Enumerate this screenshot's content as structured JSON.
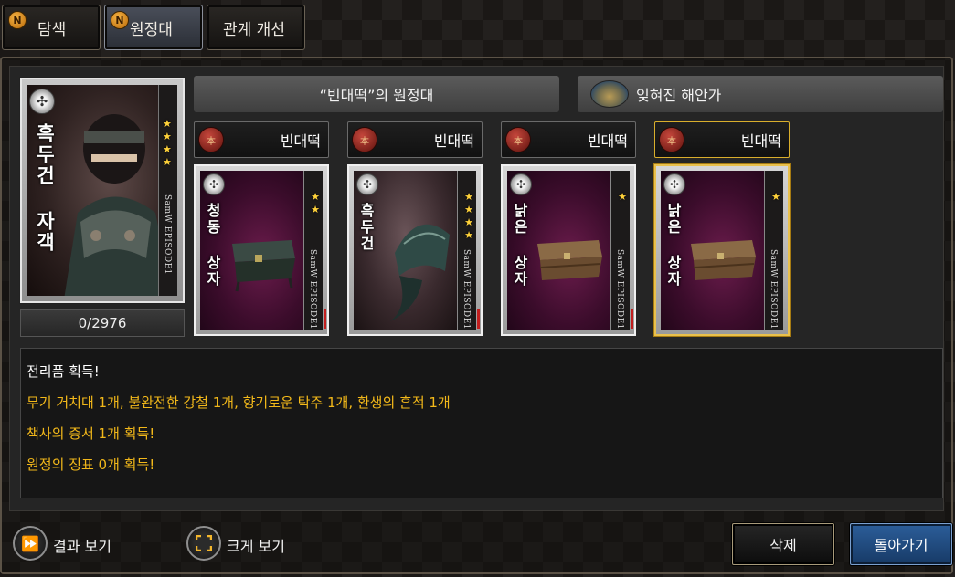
{
  "tabs": [
    {
      "label": "탐색",
      "badge": "N",
      "active": false
    },
    {
      "label": "원정대",
      "badge": "N",
      "active": true
    },
    {
      "label": "관계 개선",
      "active": false
    }
  ],
  "hero_card": {
    "name": "흑두건 자객",
    "stars": 4,
    "series": "SamW EPISODE1",
    "count": "0/2976"
  },
  "expedition_title": "“빈대떡”의 원정대",
  "region": {
    "name": "잊혀진 해안가",
    "icon": "coast-landscape-icon"
  },
  "members": [
    {
      "owner": "빈대떡",
      "badge_icon": "jade-seal-icon",
      "card_name": "청동 상자",
      "stars": 2,
      "series": "SamW EPISODE1",
      "selected": false
    },
    {
      "owner": "빈대떡",
      "badge_icon": "jade-seal-icon",
      "card_name": "흑두건",
      "stars": 4,
      "series": "SamW EPISODE1",
      "selected": false
    },
    {
      "owner": "빈대떡",
      "badge_icon": "jade-seal-icon",
      "card_name": "낡은 상자",
      "stars": 1,
      "series": "SamW EPISODE1",
      "selected": false
    },
    {
      "owner": "빈대떡",
      "badge_icon": "jade-seal-icon",
      "card_name": "낡은 상자",
      "stars": 1,
      "series": "SamW EPISODE1",
      "selected": true
    }
  ],
  "messages": {
    "heading": "전리품 획득!",
    "loot": "무기 거치대 1개, 불완전한 강철 1개, 향기로운 탁주 1개, 환생의 흔적 1개",
    "certificate": "책사의 증서 1개 획득!",
    "token": "원정의 징표 0개 획득!"
  },
  "controls": {
    "view_result": "결과 보기",
    "zoom": "크게 보기",
    "delete": "삭제",
    "back": "돌아가기"
  },
  "colors": {
    "gold_text": "#f2b81a",
    "selected_border": "#d9ae2c",
    "back_button": "#2c5e9a"
  }
}
